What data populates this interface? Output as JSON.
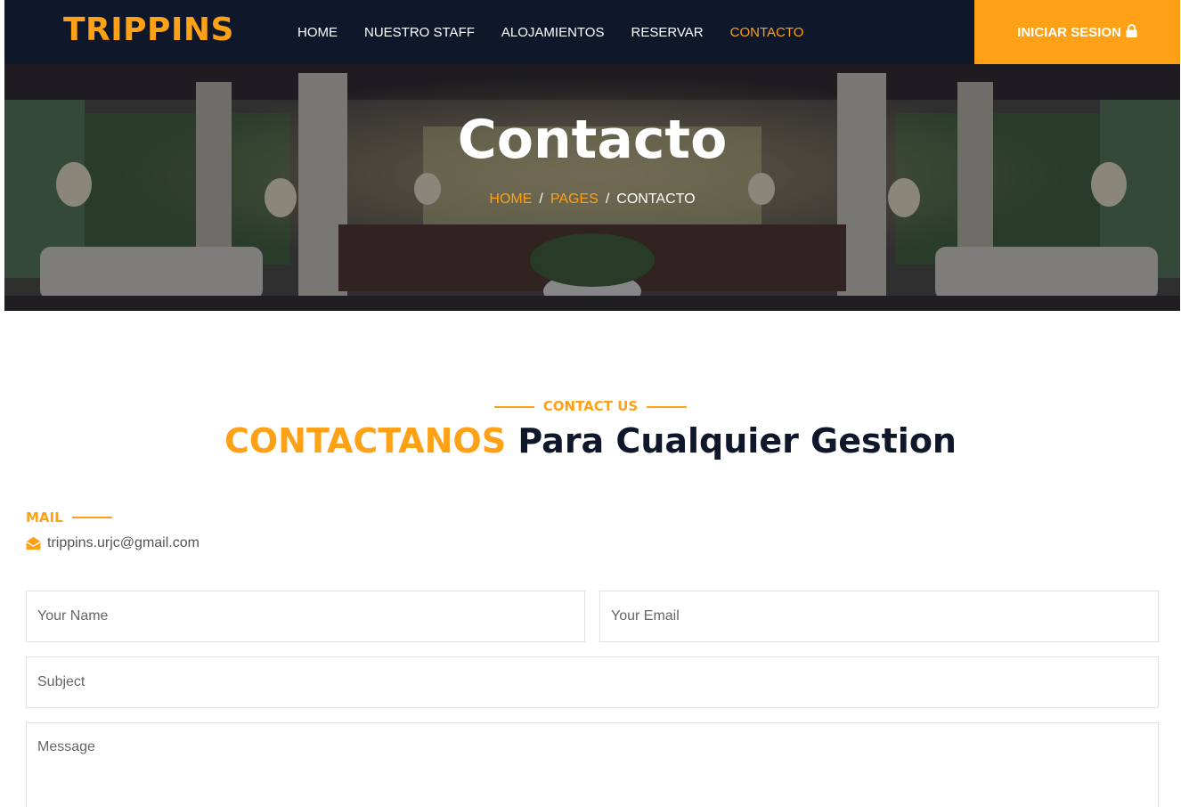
{
  "navbar": {
    "brand": "TRIPPINS",
    "links": [
      {
        "label": "HOME",
        "active": false
      },
      {
        "label": "NUESTRO STAFF",
        "active": false
      },
      {
        "label": "ALOJAMIENTOS",
        "active": false
      },
      {
        "label": "RESERVAR",
        "active": false
      },
      {
        "label": "CONTACTO",
        "active": true
      }
    ],
    "login_label": "INICIAR SESION",
    "login_icon": "lock-icon"
  },
  "hero": {
    "title": "Contacto",
    "breadcrumb": {
      "home": "HOME",
      "pages": "PAGES",
      "current": "CONTACTO",
      "separator": "/"
    }
  },
  "contact": {
    "tag": "CONTACT US",
    "title_accent": "CONTACTANOS",
    "title_rest": "Para Cualquier Gestion",
    "mail_label": "MAIL",
    "mail_icon": "envelope-open-icon",
    "email": "trippins.urjc@gmail.com"
  },
  "form": {
    "name_placeholder": "Your Name",
    "email_placeholder": "Your Email",
    "subject_placeholder": "Subject",
    "message_placeholder": "Message"
  },
  "colors": {
    "primary": "#fea116",
    "dark": "#0f172b"
  }
}
